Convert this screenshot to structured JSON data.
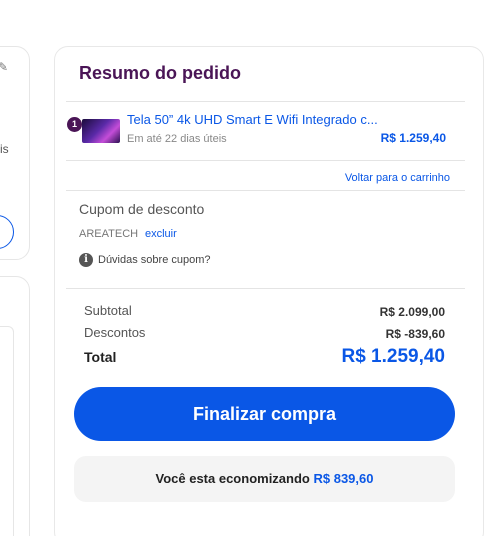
{
  "left_panel": {
    "partial_text": "is"
  },
  "summary": {
    "title": "Resumo do pedido",
    "item": {
      "quantity": "1",
      "name": "Tela 50” 4k UHD Smart E Wifi Integrado c...",
      "delivery": "Em até 22 dias úteis",
      "price": "R$ 1.259,40"
    },
    "back_link": "Voltar para o carrinho",
    "coupon": {
      "title": "Cupom de desconto",
      "code": "AREATECH",
      "remove_label": "excluir",
      "help_label": "Dúvidas sobre cupom?"
    },
    "totals": {
      "subtotal_label": "Subtotal",
      "subtotal_value": "R$ 2.099,00",
      "discount_label": "Descontos",
      "discount_value": "R$ -839,60",
      "total_label": "Total",
      "total_value": "R$ 1.259,40"
    },
    "checkout_label": "Finalizar compra",
    "savings": {
      "text": "Você esta economizando",
      "amount": "R$ 839,60"
    }
  },
  "colors": {
    "accent": "#0a57e6",
    "title": "#4a1556"
  }
}
